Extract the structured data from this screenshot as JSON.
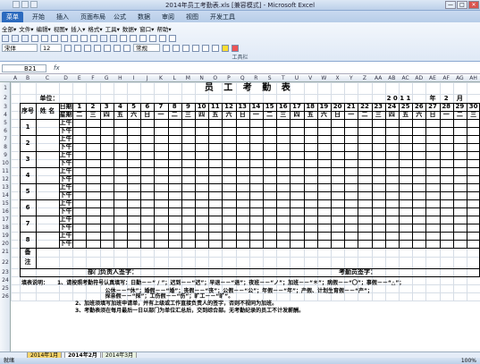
{
  "window": {
    "title": "2014年员工考勤表.xls  [兼容模式] - Microsoft Excel",
    "min": "—",
    "max": "□",
    "close": "✕"
  },
  "ribbon_tabs": [
    "菜单",
    "开始",
    "插入",
    "页面布局",
    "公式",
    "数据",
    "审阅",
    "视图",
    "开发工具"
  ],
  "menu_row": [
    "全部▾",
    "文件▾",
    "编辑▾",
    "视图▾",
    "插入▾",
    "格式▾",
    "工具▾",
    "数据▾",
    "窗口▾",
    "帮助▾"
  ],
  "font_name": "宋体",
  "font_size": "12",
  "number_format": "常规",
  "toolbar_label": "工具栏",
  "name_box": "B21",
  "fx_label": "fx",
  "columns": [
    "A",
    "B",
    "C",
    "D",
    "E",
    "F",
    "G",
    "H",
    "I",
    "J",
    "K",
    "L",
    "M",
    "N",
    "O",
    "P",
    "Q",
    "R",
    "S",
    "T",
    "U",
    "V",
    "W",
    "X",
    "Y",
    "Z",
    "AA",
    "AB",
    "AC",
    "AD",
    "AE",
    "AF",
    "AG",
    "AH"
  ],
  "rows": [
    "1",
    "2",
    "3",
    "4",
    "5",
    "6",
    "7",
    "8",
    "9",
    "10",
    "11",
    "12",
    "13",
    "14",
    "15",
    "16",
    "17",
    "18",
    "19",
    "20",
    "21",
    "22",
    "23",
    "24",
    "25",
    "26"
  ],
  "sheet": {
    "title": "员 工 考 勤 表",
    "unit_label": "单位：",
    "year": "2 0 1 1",
    "year_suffix": "年",
    "month": "2",
    "month_suffix": "月",
    "h_seq": "序号",
    "h_name": "姓 名",
    "h_date": "日期",
    "h_week": "星期",
    "days": [
      "1",
      "2",
      "3",
      "4",
      "5",
      "6",
      "7",
      "8",
      "9",
      "10",
      "11",
      "12",
      "13",
      "14",
      "15",
      "16",
      "17",
      "18",
      "19",
      "20",
      "21",
      "22",
      "23",
      "24",
      "25",
      "26",
      "27",
      "28",
      "29",
      "30",
      "31"
    ],
    "weekdays": [
      "二",
      "三",
      "四",
      "五",
      "六",
      "日",
      "一",
      "二",
      "三",
      "四",
      "五",
      "六",
      "日",
      "一",
      "二",
      "三",
      "四",
      "五",
      "六",
      "日",
      "一",
      "二",
      "三",
      "四",
      "五",
      "六",
      "日",
      "一",
      "二",
      "三",
      "四"
    ],
    "am": "上午",
    "pm": "下午",
    "employees": [
      "1",
      "2",
      "3",
      "4",
      "5",
      "6",
      "7",
      "8"
    ],
    "remark_1": "备",
    "remark_2": "注",
    "dept_sign": "部门负责人签字：",
    "att_sign": "考勤员签字：",
    "note_label": "填表说明：",
    "note1": "1、请按照考勤符号认真填写：日勤－－“ / ”；迟到－－“迟”；早退－－“退”；夜班－－“ノ”；加班－－“＊”；病假－－“〇”；事假－－“△”；",
    "note1b": "公休－－“休”；婚假－－“婚”；丧假－－“丧”；公假－－“公”；年假－－“年”；产假、计划生育假－－“产”；",
    "note1c": "探亲假－－“探”；工伤假－－“伤”；旷工－－“旷”。",
    "note2": "2、加班须填写加班申请单，并有上级或工作直接负责人的签字，否则不视同为加班。",
    "note3": "3、考勤表须在每月最后一日以部门为单位汇总后，交到综合部。无考勤纪录的员工不计发薪酬。"
  },
  "sheet_tabs": [
    "2014年1月",
    "2014年2月",
    "2014年3月"
  ],
  "status": {
    "ready": "就绪",
    "zoom": "100%"
  }
}
